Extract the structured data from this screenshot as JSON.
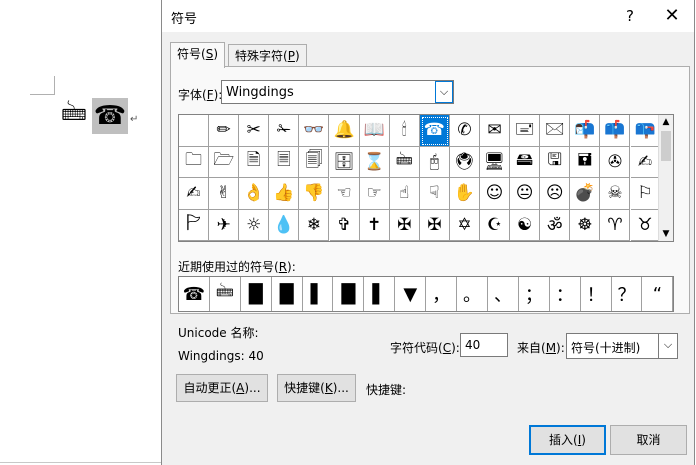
{
  "document": {
    "glyphs": [
      {
        "icon": "keyboard-icon",
        "char": "🖮"
      },
      {
        "icon": "telephone-icon",
        "char": "☎"
      }
    ],
    "pilcrow": "↵"
  },
  "dialog": {
    "title": "符号",
    "help": "?",
    "close": "✕",
    "tabs": [
      {
        "label": "符号(",
        "mnemonic": "S",
        "suffix": ")"
      },
      {
        "label": "特殊字符(",
        "mnemonic": "P",
        "suffix": ")"
      }
    ],
    "font_label": {
      "text": "字体(",
      "mnemonic": "F",
      "suffix": "):"
    },
    "font_value": "Wingdings",
    "dropdown_arrow": "⌵",
    "symbol_grid": [
      " ",
      "✏",
      "✂",
      "✁",
      "👓",
      "🔔",
      "📖",
      "🕯",
      "☎",
      "✆",
      "✉",
      "🖃",
      "🖂",
      "📬",
      "📫",
      "📪",
      "🗀",
      "🗁",
      "🗎",
      "🗏",
      "🗐",
      "🗄",
      "⌛",
      "🖮",
      "🖰",
      "🖲",
      "🖥",
      "🖴",
      "🖫",
      "🖬",
      "✇",
      "✍",
      "✍",
      "✌",
      "👌",
      "👍",
      "👎",
      "☜",
      "☞",
      "☝",
      "☟",
      "✋",
      "☺",
      "😐",
      "☹",
      "💣",
      "☠",
      "⚐",
      "🏱",
      "✈",
      "☼",
      "💧",
      "❄",
      "✞",
      "✝",
      "✠",
      "✠",
      "✡",
      "☪",
      "☯",
      "ॐ",
      "☸",
      "♈",
      "♉"
    ],
    "selected_index": 8,
    "scroll_up": "▲",
    "scroll_down": "▼",
    "recent_label": {
      "text": "近期使用过的符号(",
      "mnemonic": "R",
      "suffix": "):"
    },
    "recent_symbols": [
      "☎",
      "🖮",
      "█",
      "█",
      "▌",
      "█",
      "▌",
      "▼",
      "，",
      "。",
      "、",
      "；",
      "：",
      "！",
      "？",
      "“"
    ],
    "unicode_name_label": "Unicode 名称:",
    "unicode_name_value": "Wingdings: 40",
    "char_code_label": {
      "text": "字符代码(",
      "mnemonic": "C",
      "suffix": "):"
    },
    "char_code_value": "40",
    "from_label": {
      "text": "来自(",
      "mnemonic": "M",
      "suffix": "):"
    },
    "from_value": "符号(十进制)",
    "autocorrect_button": {
      "text": "自动更正(",
      "mnemonic": "A",
      "suffix": ")..."
    },
    "shortcut_button": {
      "text": "快捷键(",
      "mnemonic": "K",
      "suffix": ")..."
    },
    "shortcut_label": "快捷键:",
    "insert_button": {
      "text": "插入(",
      "mnemonic": "I",
      "suffix": ")"
    },
    "cancel_button": "取消"
  }
}
